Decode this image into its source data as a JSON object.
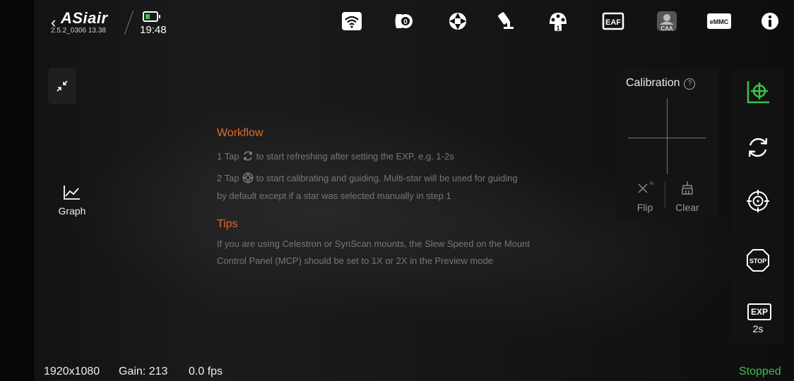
{
  "topbar": {
    "brand": "ASiair",
    "version": "2.5.2_0306 13.38",
    "time": "19:48",
    "icons": [
      "wifi-icon",
      "camera-icon",
      "guide-crosshair-icon",
      "telescope-mount-icon",
      "filter-wheel-icon",
      "eaf-icon",
      "caa-icon",
      "emmc-icon",
      "info-icon"
    ],
    "eaf_label": "EAF",
    "caa_label": "CAA",
    "emmc_label": "eMMC",
    "filter_number": "1"
  },
  "left": {
    "graph_label": "Graph"
  },
  "workflow": {
    "heading": "Workflow",
    "step1_pre": "1 Tap",
    "step1_post": "to start refreshing after setting the EXP, e.g. 1-2s",
    "step2_pre": "2 Tap",
    "step2_post": "to start calibrating and guiding. Multi-star will be used for guiding",
    "step2_cont": "by default except if a star was selected manually in step 1"
  },
  "tips": {
    "heading": "Tips",
    "line1": "If you are using Celestron or SynScan mounts, the Slew Speed on the Mount",
    "line2": "Control Panel (MCP) should be set to 1X or 2X in the Preview mode"
  },
  "calibration": {
    "title": "Calibration",
    "help": "?",
    "flip_label": "Flip",
    "flip_badge": "RA",
    "clear_label": "Clear"
  },
  "right": {
    "stop_label": "STOP",
    "exp_label": "EXP",
    "exp_value": "2s"
  },
  "statusbar": {
    "resolution": "1920x1080",
    "gain": "Gain: 213",
    "fps": "0.0 fps",
    "state": "Stopped"
  },
  "colors": {
    "accent_orange": "#e0682d",
    "accent_green": "#3bc24a"
  }
}
